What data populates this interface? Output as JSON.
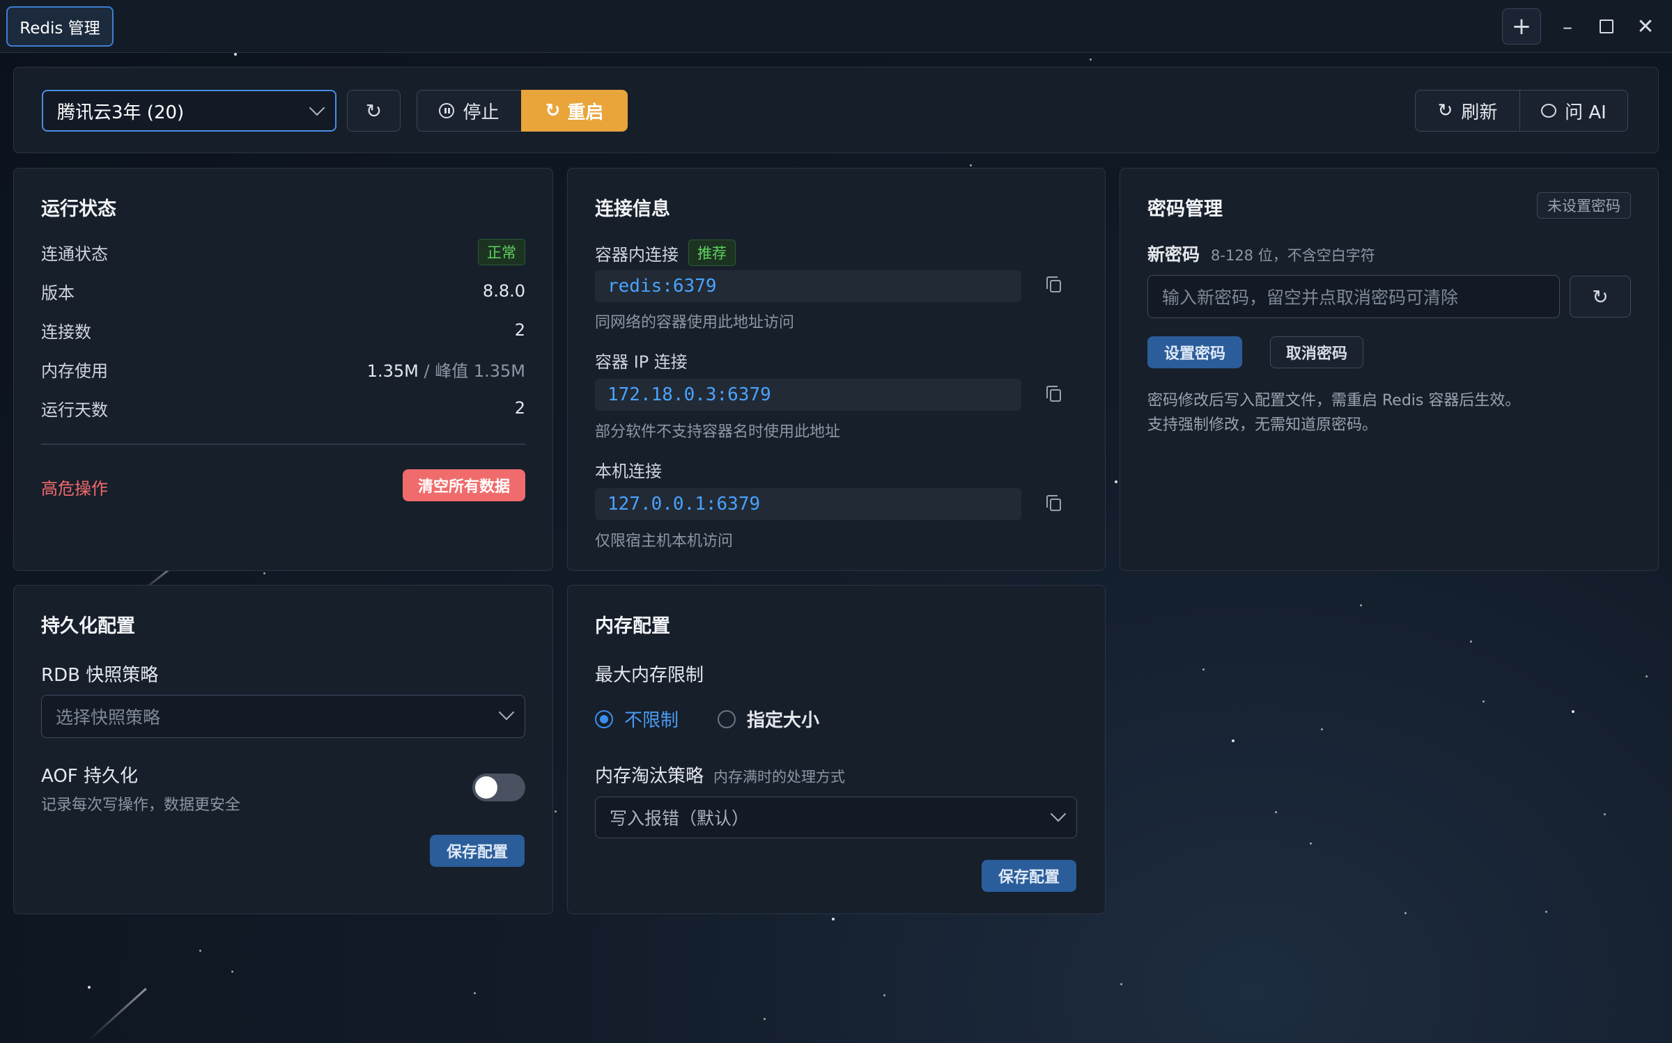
{
  "window": {
    "tab_title": "Redis 管理",
    "add_label": "+",
    "min_label": "–",
    "close_label": "✕"
  },
  "toolbar": {
    "instance": "腾讯云3年 (20)",
    "reload_icon": "↻",
    "stop_label": "停止",
    "restart_label": "重启",
    "restart_icon": "↻",
    "refresh_label": "刷新",
    "refresh_icon": "↻",
    "ask_ai_label": "问 AI"
  },
  "status": {
    "title": "运行状态",
    "rows": [
      {
        "label": "连通状态",
        "value": "正常"
      },
      {
        "label": "版本",
        "value": "8.8.0"
      },
      {
        "label": "连接数",
        "value": "2"
      },
      {
        "label": "内存使用",
        "value": "1.35M",
        "sep": " / ",
        "peak": "峰值 1.35M"
      },
      {
        "label": "运行天数",
        "value": "2"
      }
    ],
    "danger_label": "高危操作",
    "danger_button": "清空所有数据"
  },
  "connection": {
    "title": "连接信息",
    "items": [
      {
        "label": "容器内连接",
        "badge": "推荐",
        "address": "redis:6379",
        "hint": "同网络的容器使用此地址访问"
      },
      {
        "label": "容器 IP 连接",
        "address": "172.18.0.3:6379",
        "hint": "部分软件不支持容器名时使用此地址"
      },
      {
        "label": "本机连接",
        "address": "127.0.0.1:6379",
        "hint": "仅限宿主机本机访问"
      }
    ]
  },
  "password": {
    "title": "密码管理",
    "status_tag": "未设置密码",
    "new_label": "新密码",
    "new_hint": "8-128 位，不含空白字符",
    "placeholder": "输入新密码，留空并点取消密码可清除",
    "generate_icon": "↻",
    "set_button": "设置密码",
    "cancel_button": "取消密码",
    "note_line1": "密码修改后写入配置文件，需重启 Redis 容器后生效。",
    "note_line2": "支持强制修改，无需知道原密码。"
  },
  "persistence": {
    "title": "持久化配置",
    "rdb_label": "RDB 快照策略",
    "rdb_placeholder": "选择快照策略",
    "aof_label": "AOF 持久化",
    "aof_hint": "记录每次写操作，数据更安全",
    "aof_enabled": false,
    "save_button": "保存配置"
  },
  "memory": {
    "title": "内存配置",
    "max_label": "最大内存限制",
    "option_unlimited": "不限制",
    "option_specified": "指定大小",
    "selected": "不限制",
    "eviction_label": "内存淘汰策略",
    "eviction_hint": "内存满时的处理方式",
    "eviction_value": "写入报错（默认）",
    "save_button": "保存配置"
  },
  "colors": {
    "accent": "#4a8ee6",
    "warning": "#e9a43a",
    "danger": "#f06b6b",
    "success": "#5fd15f",
    "code": "#4aa3ff"
  }
}
